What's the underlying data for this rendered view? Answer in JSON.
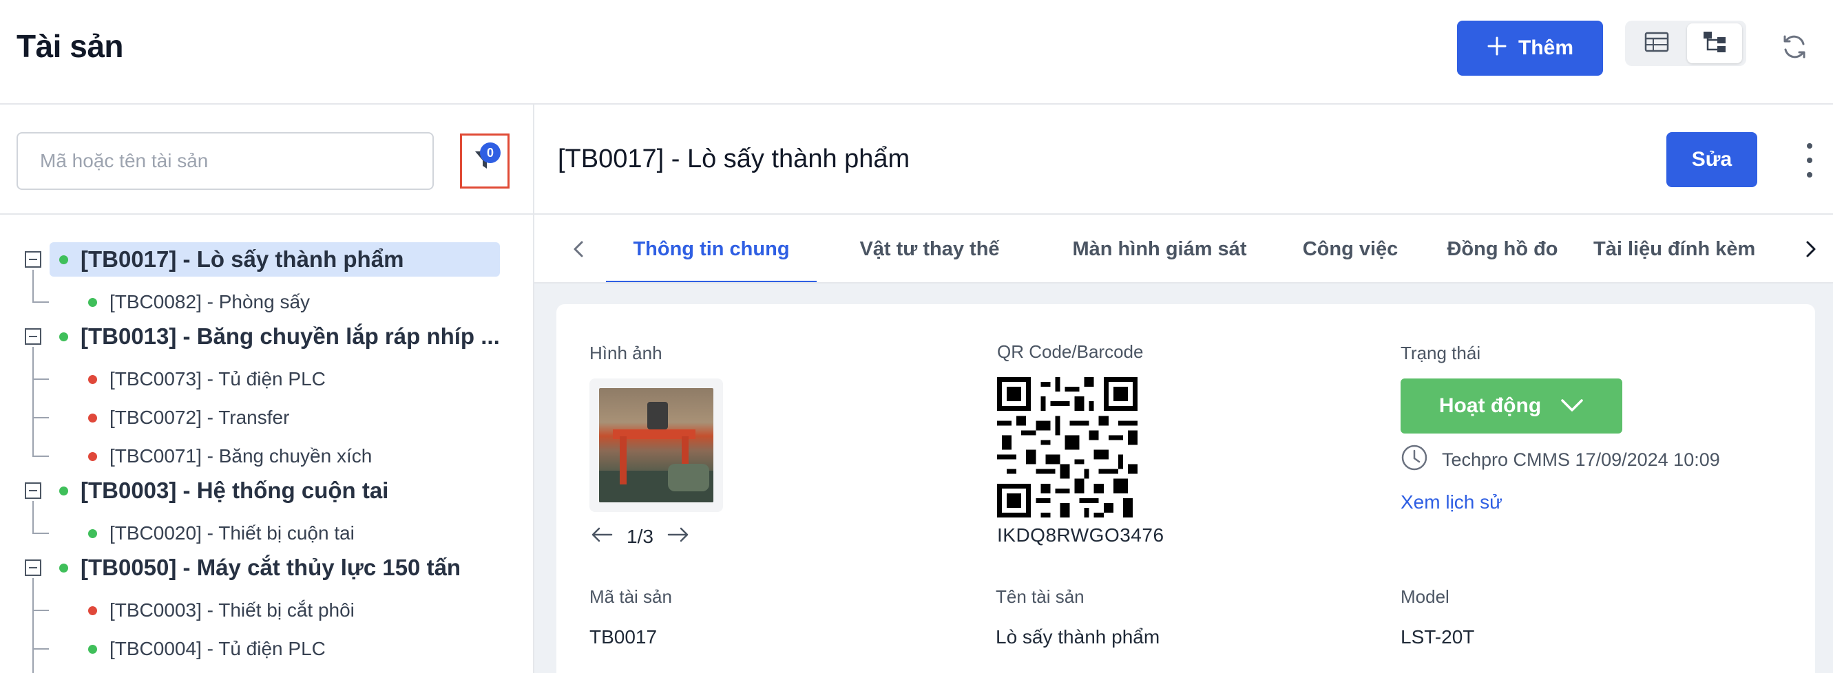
{
  "header": {
    "title": "Tài sản",
    "add_label": "Thêm",
    "add_icon": "plus-icon",
    "view_table_icon": "table-icon",
    "view_tree_icon": "tree-icon",
    "refresh_icon": "refresh-icon",
    "accent_color": "#2f5fe3"
  },
  "sidebar": {
    "search_placeholder": "Mã hoặc tên tài sản",
    "filter_count": "0",
    "tree": [
      {
        "label": "[TB0017] - Lò sấy thành phẩm",
        "status": "green",
        "selected": true,
        "children": [
          {
            "label": "[TBC0082] - Phòng sấy",
            "status": "green"
          }
        ]
      },
      {
        "label": "[TB0013] - Băng chuyền lắp ráp nhíp ...",
        "status": "green",
        "selected": false,
        "children": [
          {
            "label": "[TBC0073] - Tủ điện PLC",
            "status": "red"
          },
          {
            "label": "[TBC0072] - Transfer",
            "status": "red"
          },
          {
            "label": "[TBC0071] - Băng chuyền xích",
            "status": "red"
          }
        ]
      },
      {
        "label": "[TB0003] - Hệ thống cuộn tai",
        "status": "green",
        "selected": false,
        "children": [
          {
            "label": "[TBC0020] - Thiết bị cuộn tai",
            "status": "green"
          }
        ]
      },
      {
        "label": "[TB0050] - Máy cắt thủy lực 150 tấn",
        "status": "green",
        "selected": false,
        "children": [
          {
            "label": "[TBC0003] - Thiết bị cắt phôi",
            "status": "red"
          },
          {
            "label": "[TBC0004] - Tủ điện PLC",
            "status": "green"
          }
        ]
      }
    ]
  },
  "detail": {
    "title": "[TB0017] - Lò sấy thành phẩm",
    "edit_label": "Sửa",
    "tabs": [
      "Thông tin chung",
      "Vật tư thay thế",
      "Màn hình giám sát",
      "Công việc",
      "Đồng hồ đo",
      "Tài liệu đính kèm"
    ],
    "active_tab": 0,
    "image_label": "Hình ảnh",
    "image_pager": "1/3",
    "qr_label": "QR Code/Barcode",
    "qr_code": "IKDQ8RWGO3476",
    "status_label": "Trạng thái",
    "status_value": "Hoạt động",
    "status_color": "#5cbf6a",
    "status_meta": "Techpro CMMS 17/09/2024 10:09",
    "history_link": "Xem lịch sử",
    "fields": [
      {
        "label": "Mã tài sản",
        "value": "TB0017"
      },
      {
        "label": "Tên tài sản",
        "value": "Lò sấy thành phẩm"
      },
      {
        "label": "Model",
        "value": "LST-20T"
      }
    ]
  }
}
